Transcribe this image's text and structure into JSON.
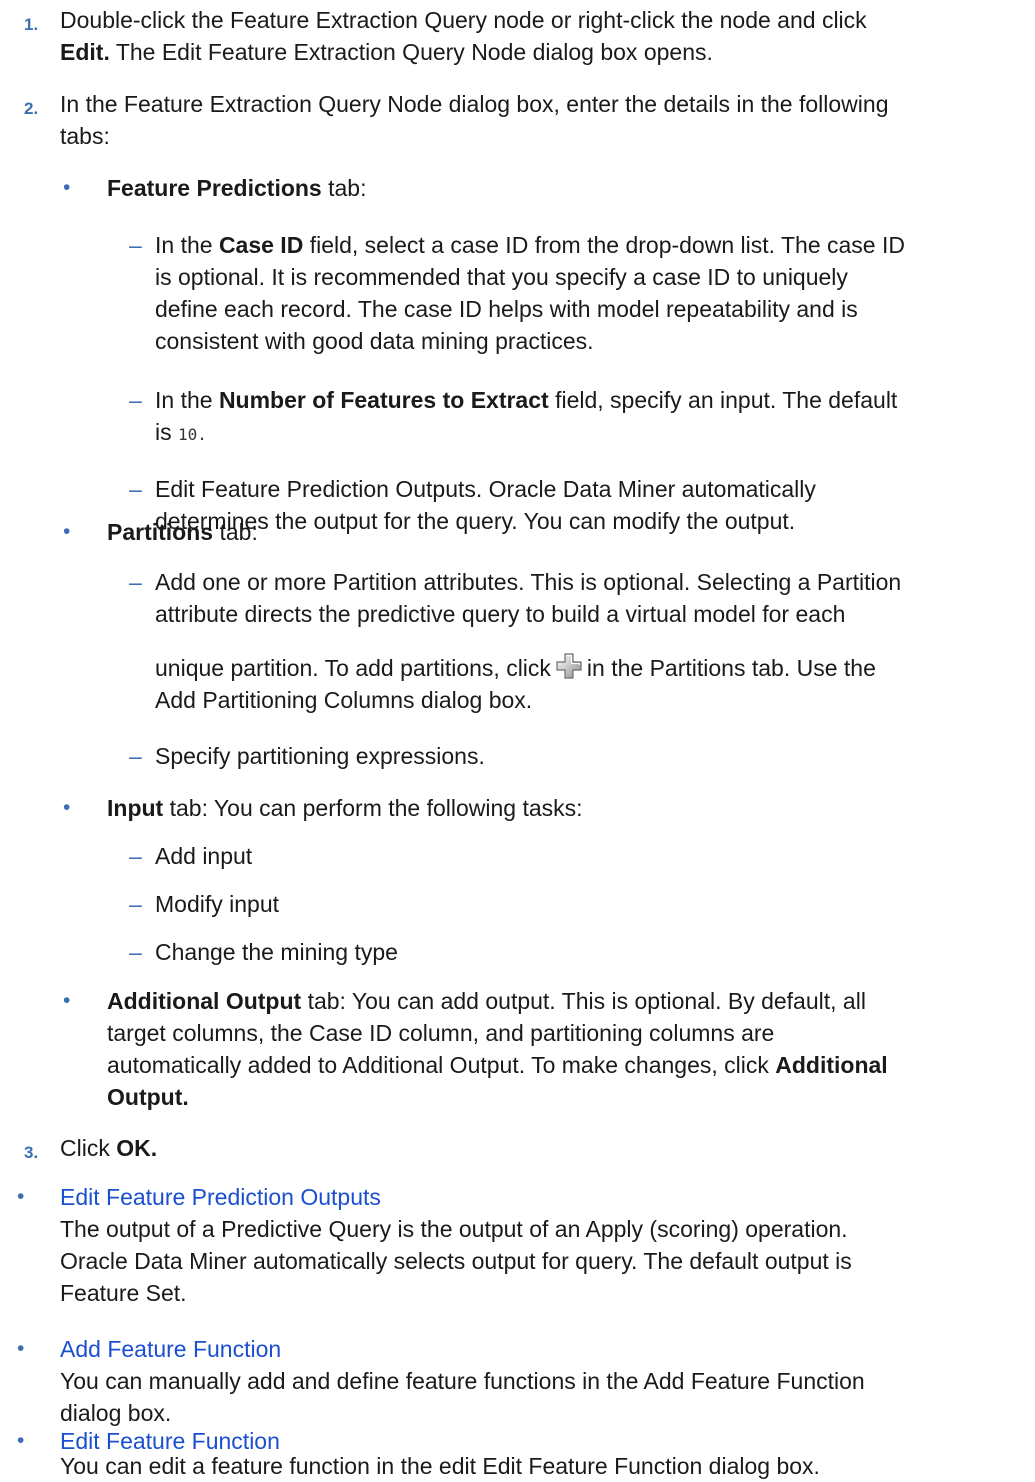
{
  "steps": [
    {
      "num": "1.",
      "p1": "Double-click the Feature Extraction Query node or right-click the node and click",
      "p2_bold": "Edit.",
      "p2_rest": " The Edit Feature Extraction Query Node dialog box opens."
    },
    {
      "num": "2.",
      "line1": "In the Feature Extraction Query Node dialog box, enter the details in the following",
      "line2": "tabs:"
    },
    {
      "num": "3.",
      "pre": "Click ",
      "bold": "OK."
    }
  ],
  "tabs": {
    "feature_predictions": {
      "bullet": "•",
      "title": "Feature Predictions",
      "suffix": " tab:",
      "items": {
        "case_id": {
          "pre": "In the ",
          "bold": "Case ID",
          "l1_rest": " field, select a case ID from the drop-down list. The case ID",
          "l2": "is optional. It is recommended that you specify a case ID to uniquely",
          "l3": "define each record. The case ID helps with model repeatability and is",
          "l4": "consistent with good data mining practices."
        },
        "num_features": {
          "pre": "In the ",
          "bold": "Number of Features to Extract",
          "l1_rest": " field, specify an input. The default",
          "l2_pre": "is ",
          "l2_code": "10",
          "l2_post": "."
        },
        "edit_outputs": {
          "l1": "Edit Feature Prediction Outputs. Oracle Data Miner automatically",
          "l2": "determines the output for the query. You can modify the output."
        }
      }
    },
    "partitions": {
      "bullet": "•",
      "title": "Partitions",
      "suffix": " tab:",
      "items": {
        "add": {
          "l1": "Add one or more Partition attributes. This is optional. Selecting a Partition",
          "l2": "attribute directs the predictive query to build a virtual model for each",
          "l3_pre": "unique partition. To add partitions, click",
          "l3_post": "in the Partitions tab. Use the",
          "l4": "Add Partitioning Columns dialog box.",
          "icon": "add-partition-plus-icon"
        },
        "specify": "Specify partitioning expressions."
      }
    },
    "input": {
      "bullet": "•",
      "title": "Input",
      "suffix": " tab: You can perform the following tasks:",
      "items": [
        "Add input",
        "Modify input",
        "Change the mining type"
      ]
    },
    "additional_output": {
      "bullet": "•",
      "title": "Additional Output",
      "l1_rest": " tab: You can add output. This is optional. By default, all",
      "l2": "target columns, the Case ID column, and partitioning columns are",
      "l3_pre": "automatically added to Additional Output. To make changes, click ",
      "l3_bold": "Additional",
      "l4_bold": "Output."
    }
  },
  "dash": "–",
  "related": [
    {
      "bullet": "•",
      "link": "Edit Feature Prediction Outputs",
      "l1": "The output of a Predictive Query is the output of an Apply (scoring) operation.",
      "l2": "Oracle Data Miner automatically selects output for query. The default output is",
      "l3": "Feature Set."
    },
    {
      "bullet": "•",
      "link": "Add Feature Function",
      "l1": "You can manually add and define feature functions in the Add Feature Function",
      "l2": "dialog box."
    },
    {
      "bullet": "•",
      "link": "Edit Feature Function",
      "l1": "You can edit a feature function in the edit Edit Feature Function dialog box."
    }
  ],
  "colors": {
    "accent": "#3d6eb4",
    "link": "#1a4fd0",
    "text": "#1a1a1a"
  }
}
